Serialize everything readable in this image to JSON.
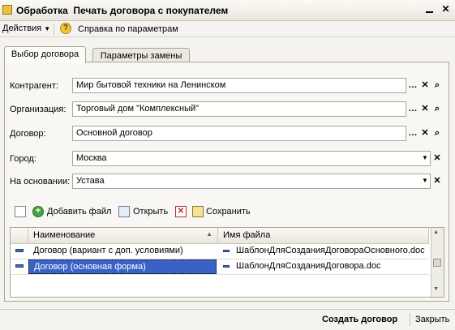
{
  "window": {
    "title": "Обработка  Печать договора с покупателем",
    "close": "✕"
  },
  "menu": {
    "actions": "Действия",
    "help": "Справка по параметрам"
  },
  "tabs": [
    {
      "label": "Выбор договора",
      "active": true
    },
    {
      "label": "Параметры замены",
      "active": false
    }
  ],
  "fields": {
    "counterparty": {
      "label": "Контрагент:",
      "value": "Мир бытовой техники на Ленинском"
    },
    "organization": {
      "label": "Организация:",
      "value": "Торговый дом \"Комплексный\""
    },
    "contract": {
      "label": "Договор:",
      "value": "Основной договор"
    },
    "city": {
      "label": "Город:",
      "value": "Москва"
    },
    "basis": {
      "label": "На основании:",
      "value": "Устава"
    }
  },
  "toolbar": {
    "add_file": "Добавить файл",
    "open": "Открыть",
    "save": "Сохранить"
  },
  "table": {
    "columns": [
      "Наименование",
      "Имя файла"
    ],
    "rows": [
      {
        "name": "Договор (вариант с доп. условиями)",
        "file": "ШаблонДляСозданияДоговораОсновного.doc",
        "selected": false
      },
      {
        "name": "Договор (основная форма)",
        "file": "ШаблонДляСозданияДоговора.doc",
        "selected": true
      }
    ]
  },
  "footer": {
    "create": "Создать договор",
    "close": "Закрыть"
  },
  "colors": {
    "selection": "#3a62c6",
    "accent": "#f1c33a"
  }
}
